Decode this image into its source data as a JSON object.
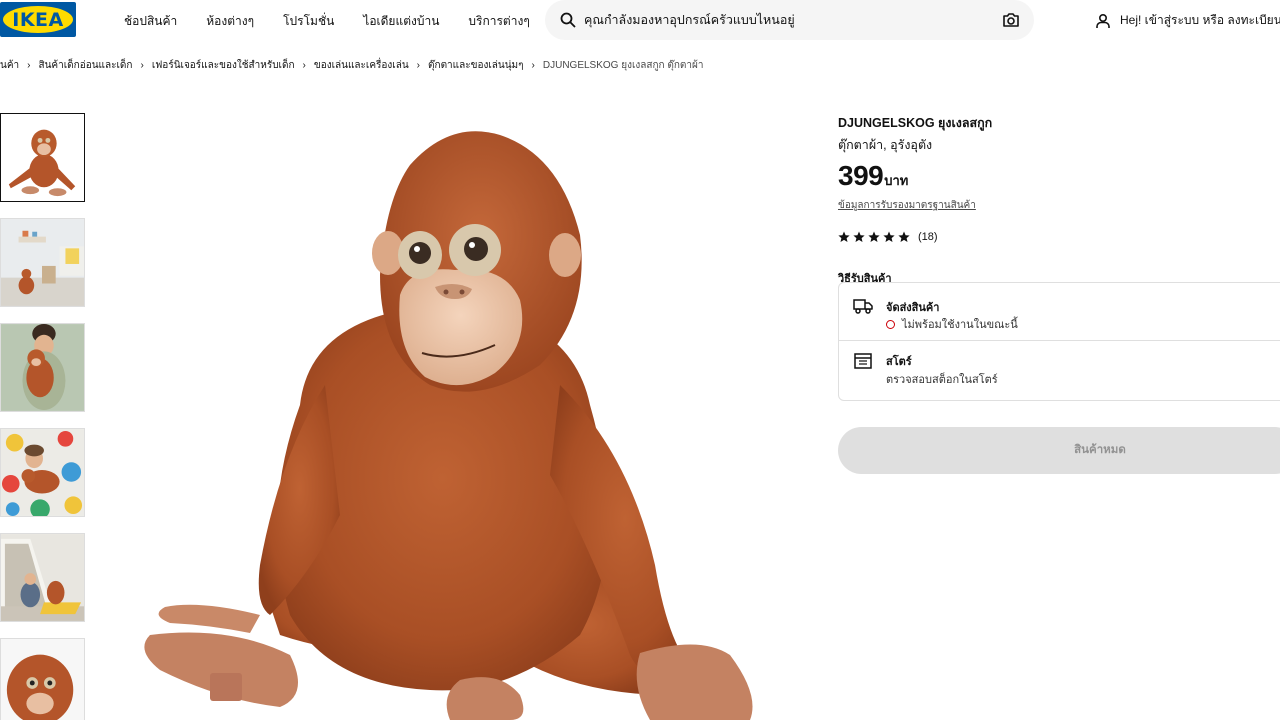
{
  "header": {
    "logo_text": "IKEA",
    "nav": [
      "ช้อปสินค้า",
      "ห้องต่างๆ",
      "โปรโมชั่น",
      "ไอเดียแต่งบ้าน",
      "บริการต่างๆ"
    ],
    "search_placeholder": "คุณกำลังมองหาอุปกรณ์ครัวแบบไหนอยู่",
    "account_label": "Hej! เข้าสู่ระบบ หรือ ลงทะเบียน"
  },
  "breadcrumb": {
    "items": [
      "นค้า",
      "สินค้าเด็กอ่อนและเด็ก",
      "เฟอร์นิเจอร์และของใช้สำหรับเด็ก",
      "ของเล่นและเครื่องเล่น",
      "ตุ๊กตาและของเล่นนุ่มๆ"
    ],
    "current": "DJUNGELSKOG ยุงเงลสกูก ตุ๊กตาผ้า",
    "separator": "›"
  },
  "product": {
    "name": "DJUNGELSKOG ยุงเงลสกูก",
    "description": "ตุ๊กตาผ้า, อุรังอุตัง",
    "price": "399",
    "currency": "บาท",
    "standard_link": "ข้อมูลการรับรองมาตรฐานสินค้า",
    "rating": 5,
    "rating_count": "(18)"
  },
  "delivery": {
    "heading": "วิธีรับสินค้า",
    "options": [
      {
        "title": "จัดส่งสินค้า",
        "status": "ไม่พร้อมใช้งานในขณะนี้",
        "icon": "truck-icon"
      },
      {
        "title": "สโตร์",
        "status": "ตรวจสอบสต็อกในสโตร์",
        "icon": "store-icon"
      }
    ]
  },
  "cta": {
    "label": "สินค้าหมด"
  },
  "colors": {
    "brand_blue": "#0058a3",
    "brand_yellow": "#ffdb00",
    "unavailable": "#cc0008",
    "fur": "#b4552a"
  }
}
